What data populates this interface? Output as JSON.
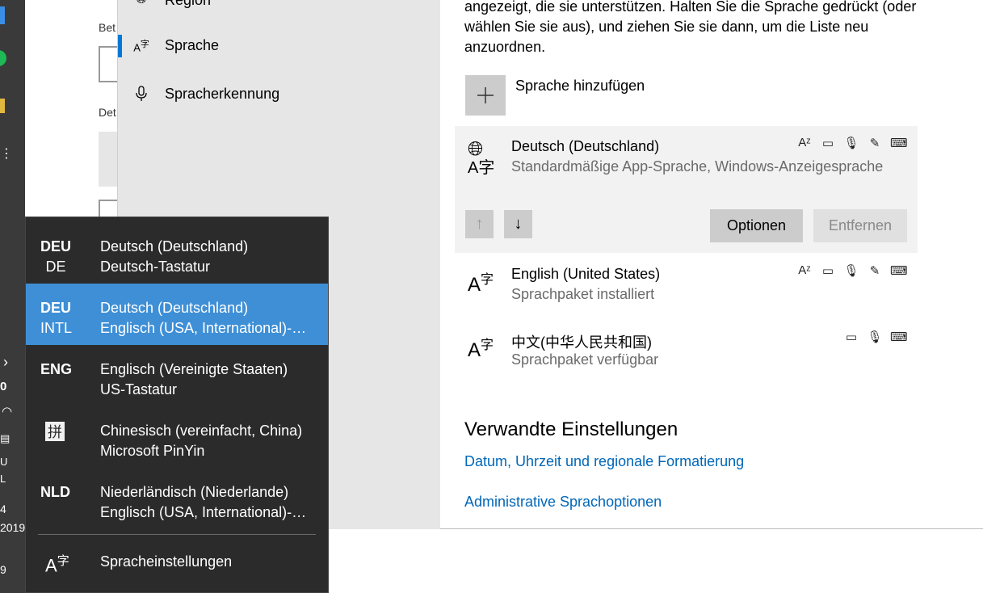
{
  "taskbar": {
    "fragments": [
      "0",
      "U",
      "L",
      "4",
      "2019",
      "9"
    ]
  },
  "bg_window": {
    "label_1": "Bet",
    "label_2": "Det"
  },
  "nav": {
    "items": [
      {
        "label": "Region",
        "icon": "globe-icon"
      },
      {
        "label": "Sprache",
        "icon": "language-icon",
        "selected": true
      },
      {
        "label": "Spracherkennung",
        "icon": "microphone-icon"
      }
    ]
  },
  "content": {
    "description": "angezeigt, die sie unterstützen. Halten Sie die Sprache gedrückt (oder wählen Sie sie aus), und ziehen Sie sie dann, um die Liste neu anzuordnen.",
    "add_language": "Sprache hinzufügen",
    "languages": [
      {
        "name": "Deutsch (Deutschland)",
        "status": "Standardmäßige App-Sprache, Windows-Anzeigesprache"
      },
      {
        "name": "English (United States)",
        "status": "Sprachpaket installiert"
      },
      {
        "name": "中文(中华人民共和国)",
        "status": "Sprachpaket verfügbar"
      }
    ],
    "options_button": "Optionen",
    "remove_button": "Entfernen",
    "related_title": "Verwandte Einstellungen",
    "links": [
      "Datum, Uhrzeit und regionale Formatierung",
      "Administrative Sprachoptionen"
    ]
  },
  "flyout": {
    "items": [
      {
        "abbr": "DEU",
        "sub": "DE",
        "name": "Deutsch (Deutschland)",
        "layout": "Deutsch-Tastatur"
      },
      {
        "abbr": "DEU",
        "sub": "INTL",
        "name": "Deutsch (Deutschland)",
        "layout": "Englisch (USA, International)-Tastatur",
        "active": true
      },
      {
        "abbr": "ENG",
        "sub": "",
        "name": "Englisch (Vereinigte Staaten)",
        "layout": "US-Tastatur"
      },
      {
        "abbr": "拼",
        "sub": "",
        "name": "Chinesisch (vereinfacht, China)",
        "layout": "Microsoft PinYin"
      },
      {
        "abbr": "NLD",
        "sub": "",
        "name": "Niederländisch (Niederlande)",
        "layout": "Englisch (USA, International)-Tastatur"
      }
    ],
    "settings": "Spracheinstellungen"
  },
  "colors": {
    "accent": "#0078d7",
    "link": "#0067b8",
    "flyout_bg": "#2b2b2b",
    "flyout_active": "#3e8fd6"
  }
}
